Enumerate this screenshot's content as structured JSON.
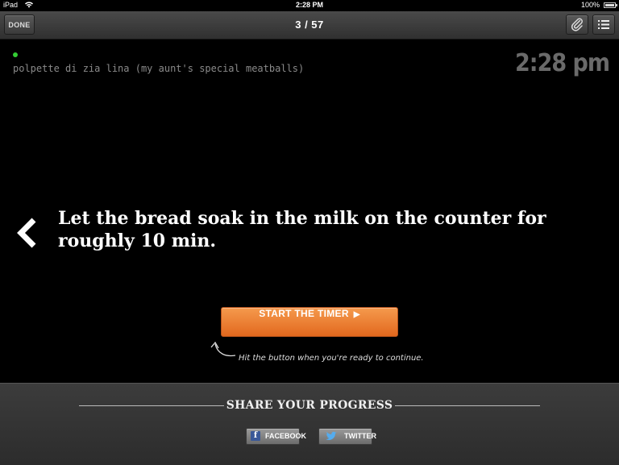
{
  "status_bar": {
    "carrier": "iPad",
    "time": "2:28 PM",
    "battery": "100%"
  },
  "toolbar": {
    "done_label": "DONE",
    "page_counter": "3 / 57"
  },
  "main": {
    "recipe_name": "polpette di zia lina (my aunt's special meatballs)",
    "clock": "2:28 pm",
    "instruction": "Let the bread soak in the milk on the counter for roughly 10 min.",
    "timer_button": "START THE TIMER",
    "hint": "Hit the button when you're ready to continue."
  },
  "footer": {
    "share_title": "SHARE YOUR PROGRESS",
    "facebook_label": "FACEBOOK",
    "twitter_label": "TWITTER"
  },
  "colors": {
    "accent_orange": "#ec7a2c",
    "status_green": "#33cc33",
    "background": "#000000"
  },
  "icons": {
    "clip": "paperclip-icon",
    "list": "list-icon",
    "prev": "chevron-left-icon",
    "play": "play-triangle-icon",
    "hint_arrow": "curved-arrow-icon",
    "facebook": "facebook-icon",
    "twitter": "twitter-bird-icon"
  }
}
